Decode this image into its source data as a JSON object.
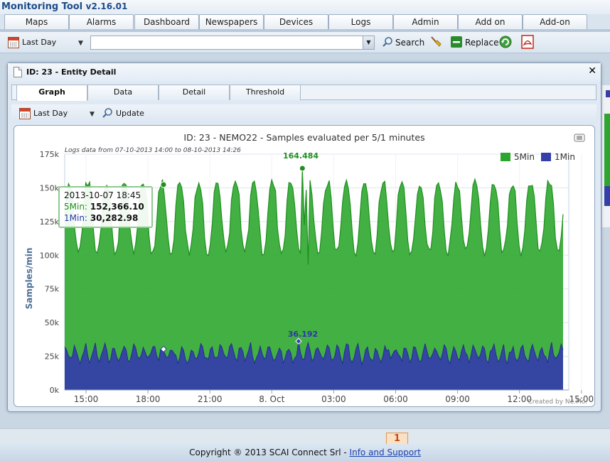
{
  "app": {
    "title": "Monitoring Tool",
    "version": "v2.16.01"
  },
  "nav_tabs": [
    "Maps",
    "Alarms",
    "Dashboard",
    "Newspapers",
    "Devices",
    "Logs",
    "Admin",
    "Add on",
    "Add-on"
  ],
  "toolbar": {
    "period_select": "Last Day",
    "search_label": "Search",
    "replace_label": "Replace"
  },
  "dialog": {
    "title": "ID: 23 - Entity Detail",
    "tabs": [
      "Graph",
      "Data",
      "Detail",
      "Threshold"
    ],
    "active_tab": "Graph",
    "period_select": "Last Day",
    "update_label": "Update"
  },
  "chart_data": {
    "type": "area",
    "title": "ID: 23 - NEMO22 - Samples evaluated per 5/1 minutes",
    "subtitle": "Logs data from 07-10-2013 14:00 to 08-10-2013 14:26",
    "ylabel": "Samples/min",
    "ylim": [
      0,
      175000
    ],
    "y_ticks": [
      "0k",
      "25k",
      "50k",
      "75k",
      "100k",
      "125k",
      "150k",
      "175k"
    ],
    "x_ticks": [
      "15:00",
      "18:00",
      "21:00",
      "8. Oct",
      "03:00",
      "06:00",
      "09:00",
      "12:00",
      "15:00"
    ],
    "legend": [
      "5Min",
      "1Min"
    ],
    "legend_position": "top-right",
    "series": [
      {
        "name": "5Min",
        "color": "#2ea52e",
        "peak_label": "164.484",
        "peak_value": 164484
      },
      {
        "name": "1Min",
        "color": "#3440a8",
        "peak_label": "36.192",
        "peak_value": 36192
      }
    ],
    "tooltip": {
      "time": "2013-10-07 18:45",
      "label_5min": "5Min:",
      "value_5min": "152,366.10",
      "label_1min": "1Min:",
      "value_1min": "30,282.98"
    },
    "credits": "Created by Ne.Mo."
  },
  "pager": {
    "current_page": "1"
  },
  "footer": {
    "copyright": "Copyright ® 2013 SCAI Connect Srl - ",
    "link": "Info and Support"
  }
}
